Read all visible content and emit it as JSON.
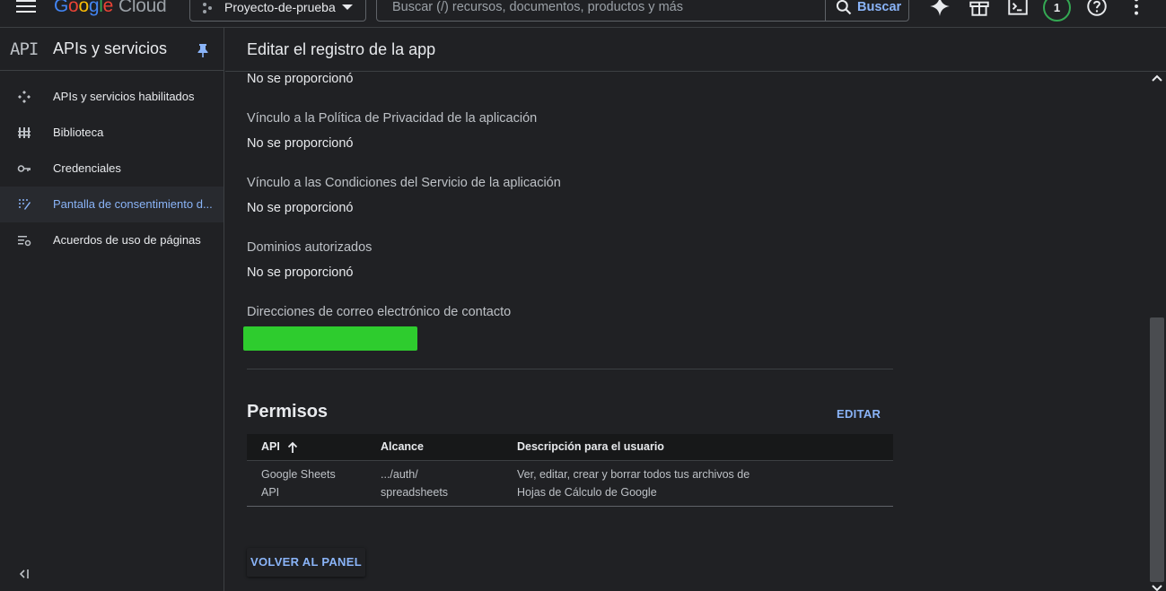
{
  "topbar": {
    "logo_google": [
      "G",
      "o",
      "o",
      "g",
      "l",
      "e"
    ],
    "logo_cloud": "Cloud",
    "project_name": "Proyecto-de-prueba",
    "search_placeholder": "Buscar (/) recursos, documentos, productos y más",
    "search_button": "Buscar",
    "notifications_count": "1",
    "icons": [
      "gemini-icon",
      "gift-icon",
      "cloud-shell-icon",
      "help-icon",
      "more-vert-icon"
    ]
  },
  "sidebar": {
    "mark": "API",
    "title": "APIs y servicios",
    "items": [
      {
        "label": "APIs y servicios habilitados",
        "icon": "apis-icon"
      },
      {
        "label": "Biblioteca",
        "icon": "library-icon"
      },
      {
        "label": "Credenciales",
        "icon": "key-icon"
      },
      {
        "label": "Pantalla de consentimiento d...",
        "icon": "consent-icon",
        "active": true
      },
      {
        "label": "Acuerdos de uso de páginas",
        "icon": "page-settings-icon"
      }
    ]
  },
  "main": {
    "title": "Editar el registro de la app",
    "fields": [
      {
        "label": "",
        "value": "No se proporcionó"
      },
      {
        "label": "Vínculo a la Política de Privacidad de la aplicación",
        "value": "No se proporcionó"
      },
      {
        "label": "Vínculo a las Condiciones del Servicio de la aplicación",
        "value": "No se proporcionó"
      },
      {
        "label": "Dominios autorizados",
        "value": "No se proporcionó"
      },
      {
        "label": "Direcciones de correo electrónico de contacto",
        "value": ""
      }
    ],
    "permissions": {
      "title": "Permisos",
      "edit_label": "EDITAR",
      "columns": [
        "API",
        "Alcance",
        "Descripción para el usuario"
      ],
      "rows": [
        {
          "api": [
            "Google Sheets",
            "API"
          ],
          "scope": [
            ".../auth/",
            "spreadsheets"
          ],
          "description": [
            "Ver, editar, crear y borrar todos tus archivos de",
            "Hojas de Cálculo de Google"
          ]
        }
      ]
    },
    "back_button": "VOLVER AL PANEL"
  },
  "colors": {
    "background": "#202124",
    "accent": "#8ab4f8",
    "redaction": "#2ecc2e",
    "badge_ring": "#34a853"
  }
}
